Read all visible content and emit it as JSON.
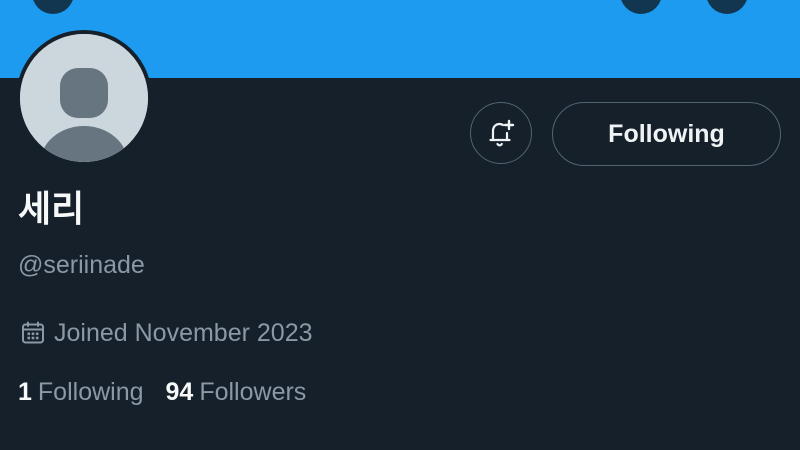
{
  "profile": {
    "display_name": "세리",
    "handle": "@seriinade",
    "joined": "Joined November 2023",
    "following_count": "1",
    "following_label": "Following",
    "followers_count": "94",
    "followers_label": "Followers"
  },
  "actions": {
    "follow_state_label": "Following",
    "notify_icon": "bell-plus-icon"
  },
  "colors": {
    "banner": "#1d9bf0",
    "background": "#15202b",
    "primary_text": "#f7f9f9",
    "secondary_text": "#8b98a5",
    "border": "#536471"
  }
}
